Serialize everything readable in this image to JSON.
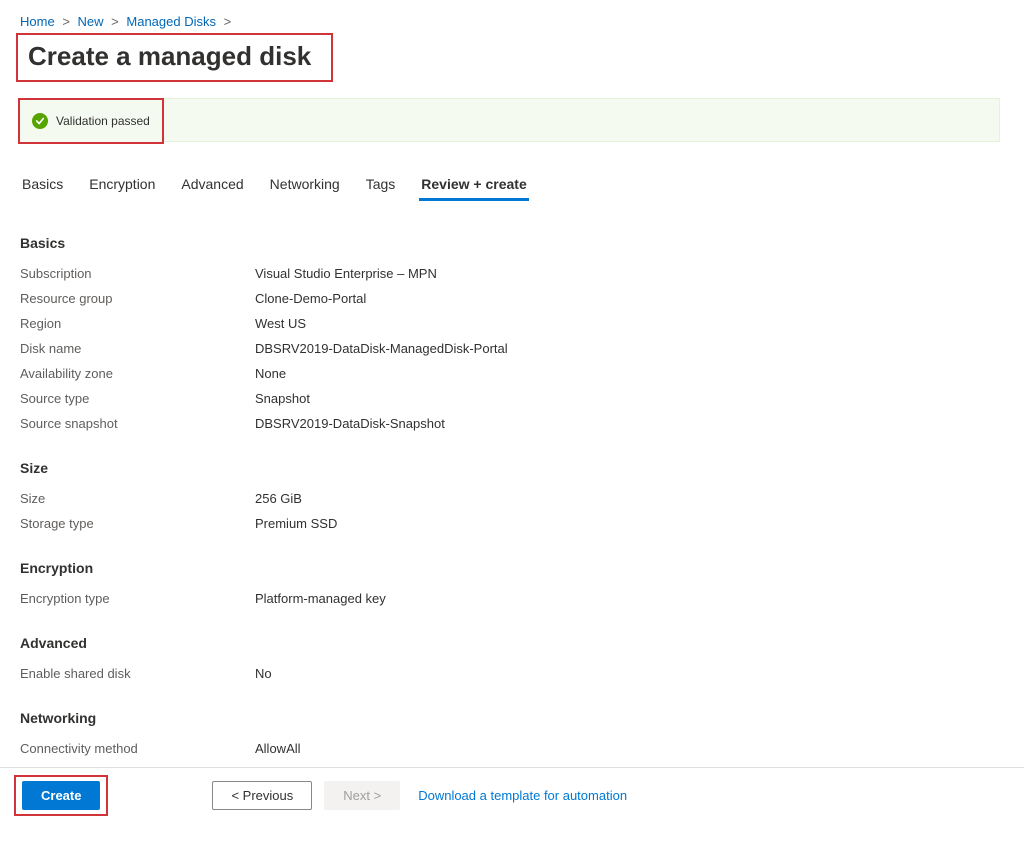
{
  "breadcrumb": {
    "home": "Home",
    "new": "New",
    "managed_disks": "Managed Disks"
  },
  "page_title": "Create a managed disk",
  "validation": {
    "text": "Validation passed"
  },
  "tabs": {
    "basics": "Basics",
    "encryption": "Encryption",
    "advanced": "Advanced",
    "networking": "Networking",
    "tags": "Tags",
    "review": "Review + create"
  },
  "sections": {
    "basics": {
      "title": "Basics",
      "rows": {
        "subscription_label": "Subscription",
        "subscription_value": "Visual Studio Enterprise – MPN",
        "rg_label": "Resource group",
        "rg_value": "Clone-Demo-Portal",
        "region_label": "Region",
        "region_value": "West US",
        "diskname_label": "Disk name",
        "diskname_value": "DBSRV2019-DataDisk-ManagedDisk-Portal",
        "az_label": "Availability zone",
        "az_value": "None",
        "srctype_label": "Source type",
        "srctype_value": "Snapshot",
        "srcsnap_label": "Source snapshot",
        "srcsnap_value": "DBSRV2019-DataDisk-Snapshot"
      }
    },
    "size": {
      "title": "Size",
      "rows": {
        "size_label": "Size",
        "size_value": "256 GiB",
        "storage_label": "Storage type",
        "storage_value": "Premium SSD"
      }
    },
    "encryption": {
      "title": "Encryption",
      "rows": {
        "enc_label": "Encryption type",
        "enc_value": "Platform-managed key"
      }
    },
    "advanced": {
      "title": "Advanced",
      "rows": {
        "shared_label": "Enable shared disk",
        "shared_value": "No"
      }
    },
    "networking": {
      "title": "Networking",
      "rows": {
        "conn_label": "Connectivity method",
        "conn_value": "AllowAll"
      }
    }
  },
  "footer": {
    "create": "Create",
    "previous": "< Previous",
    "next": "Next >",
    "template_link": "Download a template for automation"
  }
}
